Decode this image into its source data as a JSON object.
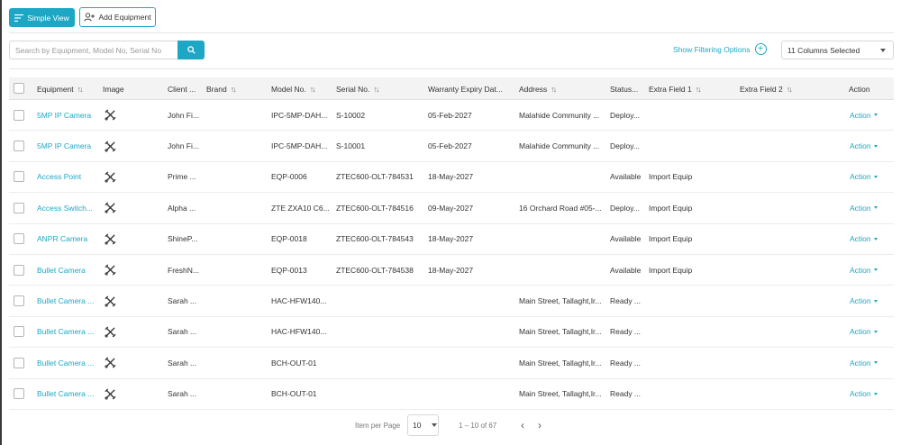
{
  "toolbar": {
    "simple_view_label": "Simple View",
    "simple_view_icon": "list-icon",
    "add_equipment_label": "Add Equipment",
    "add_equipment_icon": "add-user-icon"
  },
  "search": {
    "placeholder": "Search by Equipment, Model No, Serial No",
    "icon": "search-icon"
  },
  "filters": {
    "show_filtering_label": "Show Filtering Options",
    "columns_selected": "11 Columns Selected"
  },
  "table": {
    "columns": {
      "equipment": "Equipment",
      "image": "Image",
      "client": "Client ...",
      "brand": "Brand",
      "model": "Model No.",
      "serial": "Serial No.",
      "warranty": "Warranty Expiry Dat...",
      "address": "Address",
      "status": "Status...",
      "extra1": "Extra Field 1",
      "extra2": "Extra Field 2",
      "action": "Action"
    },
    "rows": [
      {
        "equipment": "5MP IP Camera",
        "client": "John Fi...",
        "brand": "",
        "model": "IPC-5MP-DAH...",
        "serial": "S-10002",
        "warranty": "05-Feb-2027",
        "address": "Malahide Community ...",
        "status": "Deploy...",
        "extra1": "",
        "extra2": "",
        "action": "Action"
      },
      {
        "equipment": "5MP IP Camera",
        "client": "John Fi...",
        "brand": "",
        "model": "IPC-5MP-DAH...",
        "serial": "S-10001",
        "warranty": "05-Feb-2027",
        "address": "Malahide Community ...",
        "status": "Deploy...",
        "extra1": "",
        "extra2": "",
        "action": "Action"
      },
      {
        "equipment": "Access Point",
        "client": "Prime ...",
        "brand": "",
        "model": "EQP-0006",
        "serial": "ZTEC600-OLT-784531",
        "warranty": "18-May-2027",
        "address": "",
        "status": "Available",
        "extra1": "Import Equip",
        "extra2": "",
        "action": "Action"
      },
      {
        "equipment": "Access Switch...",
        "client": "Alpha ...",
        "brand": "",
        "model": "ZTE ZXA10 C6...",
        "serial": "ZTEC600-OLT-784516",
        "warranty": "09-May-2027",
        "address": "16 Orchard Road #05-...",
        "status": "Deploy...",
        "extra1": "Import Equip",
        "extra2": "",
        "action": "Action"
      },
      {
        "equipment": "ANPR Camera",
        "client": "ShineP...",
        "brand": "",
        "model": "EQP-0018",
        "serial": "ZTEC600-OLT-784543",
        "warranty": "18-May-2027",
        "address": "",
        "status": "Available",
        "extra1": "Import Equip",
        "extra2": "",
        "action": "Action"
      },
      {
        "equipment": "Bullet Camera",
        "client": "FreshN...",
        "brand": "",
        "model": "EQP-0013",
        "serial": "ZTEC600-OLT-784538",
        "warranty": "18-May-2027",
        "address": "",
        "status": "Available",
        "extra1": "Import Equip",
        "extra2": "",
        "action": "Action"
      },
      {
        "equipment": "Bullet Camera ...",
        "client": "Sarah ...",
        "brand": "",
        "model": "HAC-HFW140...",
        "serial": "",
        "warranty": "",
        "address": "Main Street, Tallaght,Ir...",
        "status": "Ready ...",
        "extra1": "",
        "extra2": "",
        "action": "Action"
      },
      {
        "equipment": "Bullet Camera ...",
        "client": "Sarah ...",
        "brand": "",
        "model": "HAC-HFW140...",
        "serial": "",
        "warranty": "",
        "address": "Main Street, Tallaght,Ir...",
        "status": "Ready ...",
        "extra1": "",
        "extra2": "",
        "action": "Action"
      },
      {
        "equipment": "Bullet Camera ...",
        "client": "Sarah ...",
        "brand": "",
        "model": "BCH-OUT-01",
        "serial": "",
        "warranty": "",
        "address": "Main Street, Tallaght,Ir...",
        "status": "Ready ...",
        "extra1": "",
        "extra2": "",
        "action": "Action"
      },
      {
        "equipment": "Bullet Camera ...",
        "client": "Sarah ...",
        "brand": "",
        "model": "BCH-OUT-01",
        "serial": "",
        "warranty": "",
        "address": "Main Street, Tallaght,Ir...",
        "status": "Ready ...",
        "extra1": "",
        "extra2": "",
        "action": "Action"
      }
    ]
  },
  "pagination": {
    "items_per_page_label": "Item per Page",
    "items_per_page_value": "10",
    "range": "1 – 10 of 67",
    "prev_icon": "chevron-left-icon",
    "next_icon": "chevron-right-icon"
  },
  "colors": {
    "accent": "#1ea7c5",
    "header_bg": "#f3f3f3"
  }
}
